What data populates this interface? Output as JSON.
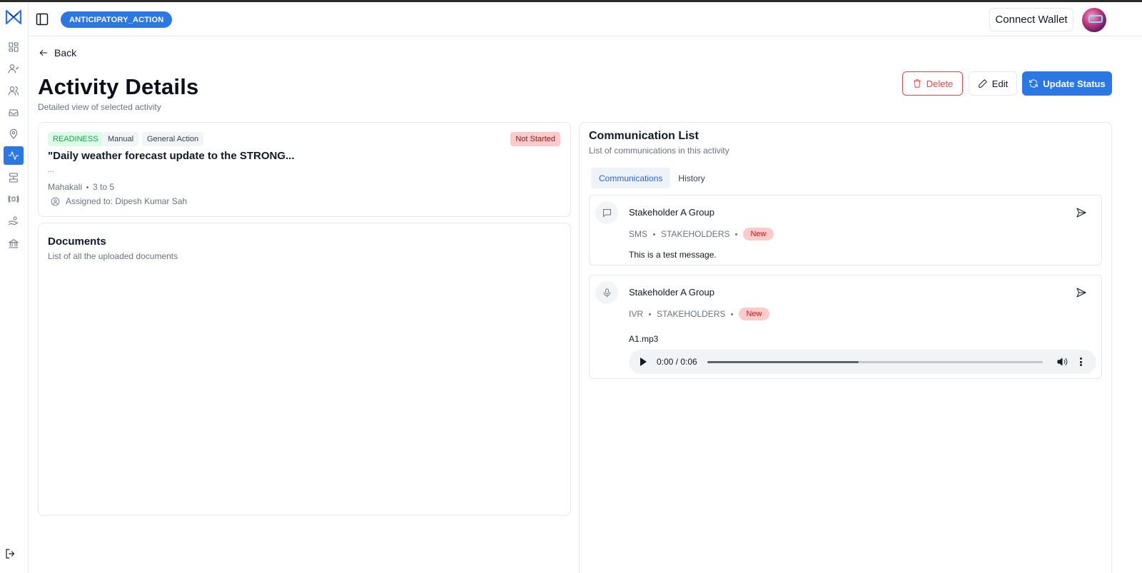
{
  "header": {
    "project_badge": "ANTICIPATORY_ACTION",
    "connect_wallet_label": "Connect Wallet"
  },
  "sidebar": {
    "items": [
      {
        "icon": "dashboard-icon"
      },
      {
        "icon": "user-icon"
      },
      {
        "icon": "users-icon"
      },
      {
        "icon": "inbox-icon"
      },
      {
        "icon": "location-icon"
      },
      {
        "icon": "activity-icon",
        "active": true
      },
      {
        "icon": "layers-icon"
      },
      {
        "icon": "broadcast-icon"
      },
      {
        "icon": "hand-coins-icon"
      },
      {
        "icon": "bank-icon"
      }
    ],
    "logout_icon": "logout-icon"
  },
  "page": {
    "back_label": "Back",
    "title": "Activity Details",
    "subtitle": "Detailed view of selected activity",
    "actions": {
      "delete_label": "Delete",
      "edit_label": "Edit",
      "update_status_label": "Update Status"
    }
  },
  "activity": {
    "tags": [
      "READINESS",
      "Manual",
      "General Action"
    ],
    "status": "Not Started",
    "title": "\"Daily weather forecast update to the STRONG...",
    "ellipsis": "...",
    "location": "Mahakali",
    "range": "3 to 5",
    "assigned_to": "Assigned to: Dipesh Kumar Sah"
  },
  "documents": {
    "title": "Documents",
    "subtitle": "List of all the uploaded documents"
  },
  "communications": {
    "title": "Communication List",
    "subtitle": "List of communications in this activity",
    "tabs": [
      "Communications",
      "History"
    ],
    "active_tab": "Communications",
    "items": [
      {
        "icon": "message-icon",
        "name": "Stakeholder A Group",
        "channel": "SMS",
        "group": "STAKEHOLDERS",
        "badge": "New",
        "body": "This is a test message."
      },
      {
        "icon": "microphone-icon",
        "name": "Stakeholder A Group",
        "channel": "IVR",
        "group": "STAKEHOLDERS",
        "badge": "New",
        "file": "A1.mp3",
        "audio_time": "0:00 / 0:06",
        "audio_progress": 0.45
      }
    ]
  },
  "colors": {
    "accent": "#2b78e4",
    "danger": "#ef4444",
    "readiness": "#16a34a"
  }
}
